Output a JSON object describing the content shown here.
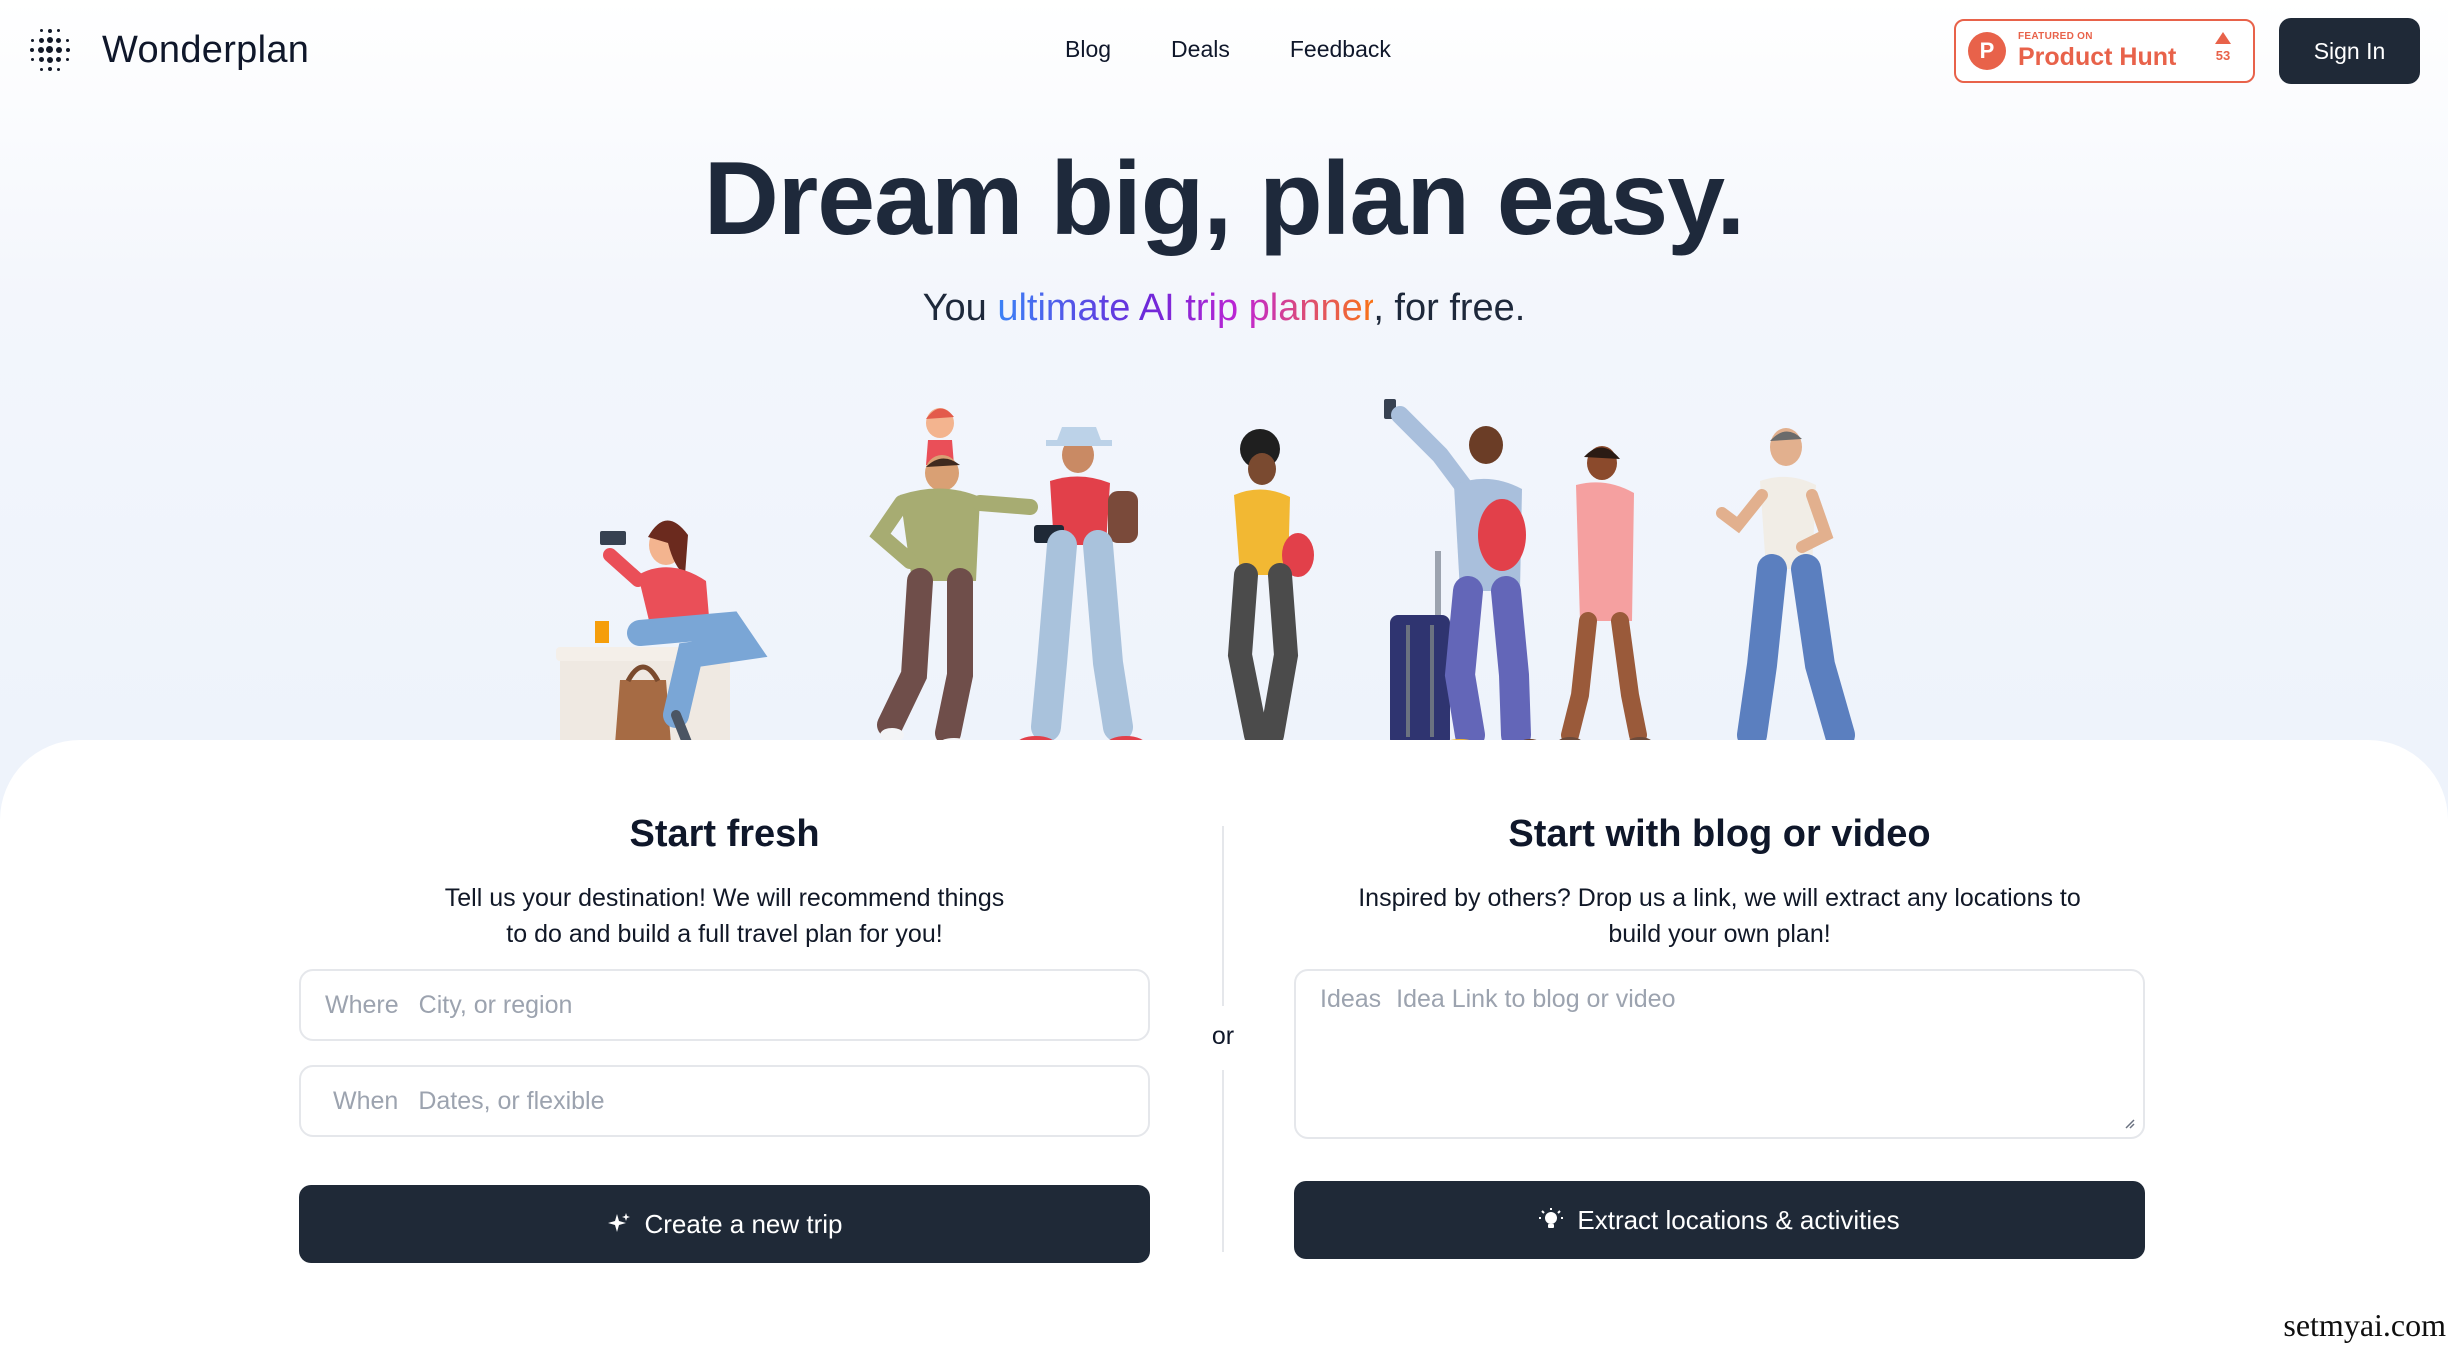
{
  "brand": {
    "name": "Wonderplan",
    "logo_icon": "dot-grid-logo"
  },
  "nav": {
    "items": [
      "Blog",
      "Deals",
      "Feedback"
    ]
  },
  "product_hunt": {
    "featured": "FEATURED ON",
    "name": "Product Hunt",
    "votes": "53",
    "letter": "P",
    "color": "#e8624a"
  },
  "signin_label": "Sign In",
  "hero": {
    "title": "Dream big, plan easy.",
    "subtitle_prefix": "You ",
    "subtitle_highlight": "ultimate AI trip planner",
    "subtitle_suffix": ", for free."
  },
  "illustration": {
    "icon": "travelers-illustration"
  },
  "start_fresh": {
    "title": "Start fresh",
    "desc_line1": "Tell us your destination! We will recommend things",
    "desc_line2": "to do and build a full travel plan for you!",
    "where_label": "Where",
    "where_placeholder": "City, or region",
    "when_label": "When",
    "when_placeholder": "Dates, or flexible",
    "button_label": "Create a new trip",
    "button_icon": "sparkles-icon"
  },
  "separator": "or",
  "blog_video": {
    "title": "Start with blog or video",
    "desc_line1": "Inspired by others? Drop us a link, we will extract any locations to",
    "desc_line2": "build your own plan!",
    "ideas_label": "Ideas",
    "ideas_placeholder": "Idea Link to blog or video",
    "button_label": "Extract locations & activities",
    "button_icon": "lightbulb-icon"
  },
  "watermark": "setmyai.com",
  "colors": {
    "primary": "#1f2937",
    "text": "#1e293b",
    "accent": "#e8624a"
  }
}
